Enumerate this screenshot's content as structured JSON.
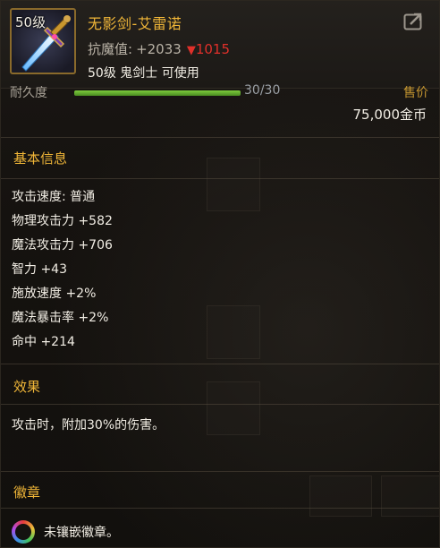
{
  "item": {
    "level_badge": "50级",
    "name": "无影剑-艾雷诺",
    "resist_label": "抗魔值:",
    "resist_value": "+2033",
    "resist_arrow": "▼",
    "resist_down": "1015",
    "requirement": "50级 鬼剑士 可使用"
  },
  "durability": {
    "label": "耐久度",
    "value_text": "30/30",
    "fraction": 1.0,
    "sell_label": "售价",
    "price": "75,000金币"
  },
  "basic_info": {
    "title": "基本信息",
    "stats": [
      "攻击速度: 普通",
      "物理攻击力 +582",
      "魔法攻击力 +706",
      "智力 +43",
      "施放速度 +2%",
      "魔法暴击率 +2%",
      "命中 +214"
    ]
  },
  "effect": {
    "title": "效果",
    "text": "攻击时，附加30%的伤害。"
  },
  "emblem": {
    "title": "徽章",
    "text": "未镶嵌徽章。"
  },
  "colors": {
    "name_gold": "#f0b638",
    "down_red": "#e0302a",
    "durability_green": "#7dcc3c"
  },
  "icons": [
    "sword-item-icon",
    "share-icon",
    "emblem-slot-icon"
  ]
}
